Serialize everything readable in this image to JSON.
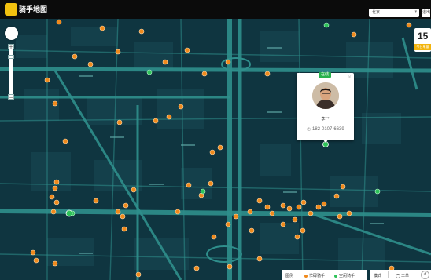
{
  "app": {
    "title": "骑手地图",
    "city_select": "北京",
    "city_caret": "▾",
    "top_right_label": "退出"
  },
  "zoom": {
    "in_label": "+",
    "out_label": "−"
  },
  "date_card": {
    "day": "15",
    "tag": "今日单量"
  },
  "popup": {
    "status": "在线",
    "close": "×",
    "name": "李**",
    "phone_icon": "✆",
    "phone": "182-0107-6639"
  },
  "legend": {
    "title": "图例",
    "busy": "忙碌骑手",
    "idle": "空闲骑手",
    "busy_color": "#f08a1c",
    "idle_color": "#2ec35a"
  },
  "controls": {
    "layer": "模式",
    "radio_label": "工单",
    "button": "↺"
  },
  "map_colors": {
    "background": "#0f3540",
    "road": "#2f8f8c",
    "building": "#1f5660",
    "label": "#5fa9a6"
  },
  "markers": {
    "busy_count": 68,
    "idle_count": 5
  }
}
